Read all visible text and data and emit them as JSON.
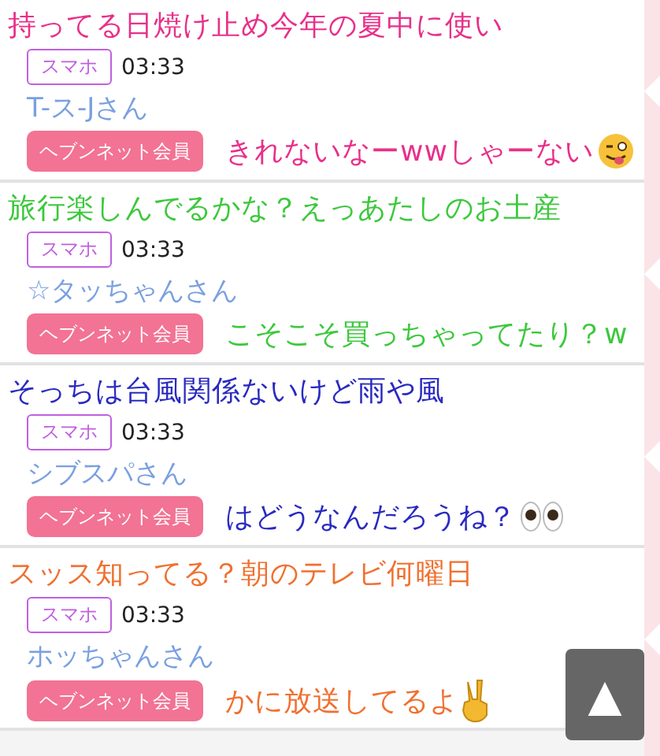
{
  "posts": [
    {
      "badge": "スマホ",
      "time": "03:33",
      "name": "T-ス-Jさん",
      "button": "ヘブンネット会員",
      "comment": {
        "lines": [
          "持ってる日焼け止め今年の夏中に使い",
          "きれないなーwwしゃーない"
        ],
        "color": "#e8308a",
        "kind": "wink"
      }
    },
    {
      "badge": "スマホ",
      "time": "03:33",
      "name": "☆タッちゃんさん",
      "button": "ヘブンネット会員",
      "comment": {
        "lines": [
          "旅行楽しんでるかな？えっあたしのお土産",
          "こそこそ買っちゃってたり？w"
        ],
        "color": "#3cc83c",
        "kind": "plain"
      }
    },
    {
      "badge": "スマホ",
      "time": "03:33",
      "name": "シブスパさん",
      "button": "ヘブンネット会員",
      "comment": {
        "lines": [
          "そっちは台風関係ないけど雨や風",
          "はどうなんだろうね？"
        ],
        "color": "#2a2ac0",
        "kind": "eyes"
      }
    },
    {
      "badge": "スマホ",
      "time": "03:33",
      "name": "ホッちゃんさん",
      "button": "ヘブンネット会員",
      "comment": {
        "lines": [
          "スッス知ってる？朝のテレビ何曜日",
          "かに放送してるよ"
        ],
        "color": "#f07030",
        "kind": "peace"
      }
    }
  ],
  "scroll_top": {
    "label": "▲"
  }
}
